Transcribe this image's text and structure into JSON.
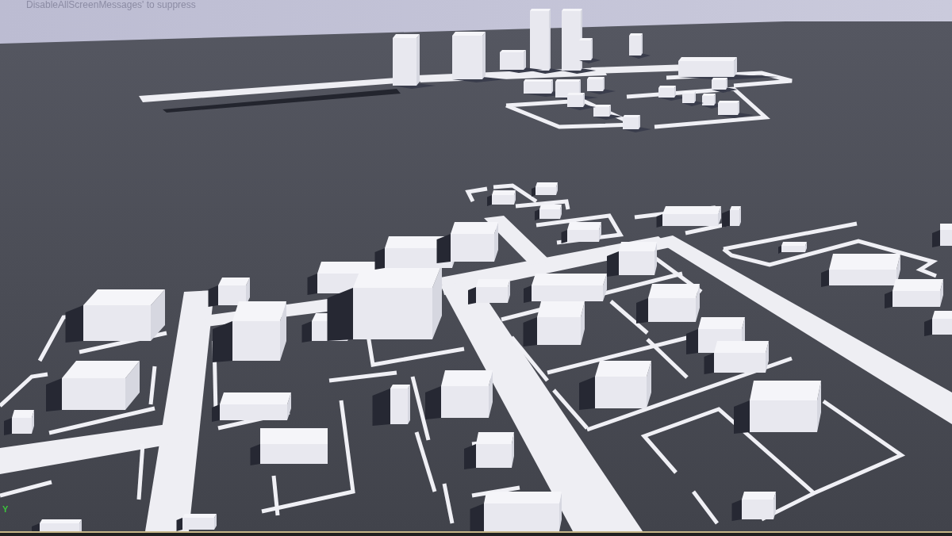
{
  "viewport": {
    "screen_message": "DisableAllScreenMessages' to suppress",
    "axis_label": "Y"
  }
}
